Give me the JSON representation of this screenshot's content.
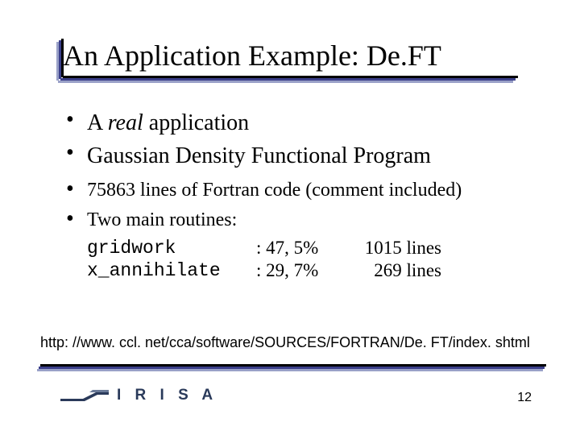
{
  "title": "An Application Example: De.FT",
  "bullets": {
    "b1_prefix": "A ",
    "b1_italic": "real",
    "b1_suffix": " application",
    "b2": "Gaussian Density Functional Program",
    "b3": "75863 lines of Fortran code (comment included)",
    "b4": "Two main routines:"
  },
  "routines": [
    {
      "name": "gridwork",
      "pct": ": 47, 5%",
      "lines": "1015 lines"
    },
    {
      "name": "x_annihilate",
      "pct": ": 29, 7%",
      "lines": "269 lines"
    }
  ],
  "url": "http: //www. ccl. net/cca/software/SOURCES/FORTRAN/De. FT/index. shtml",
  "logo_text": "I R I S A",
  "page_number": "12"
}
